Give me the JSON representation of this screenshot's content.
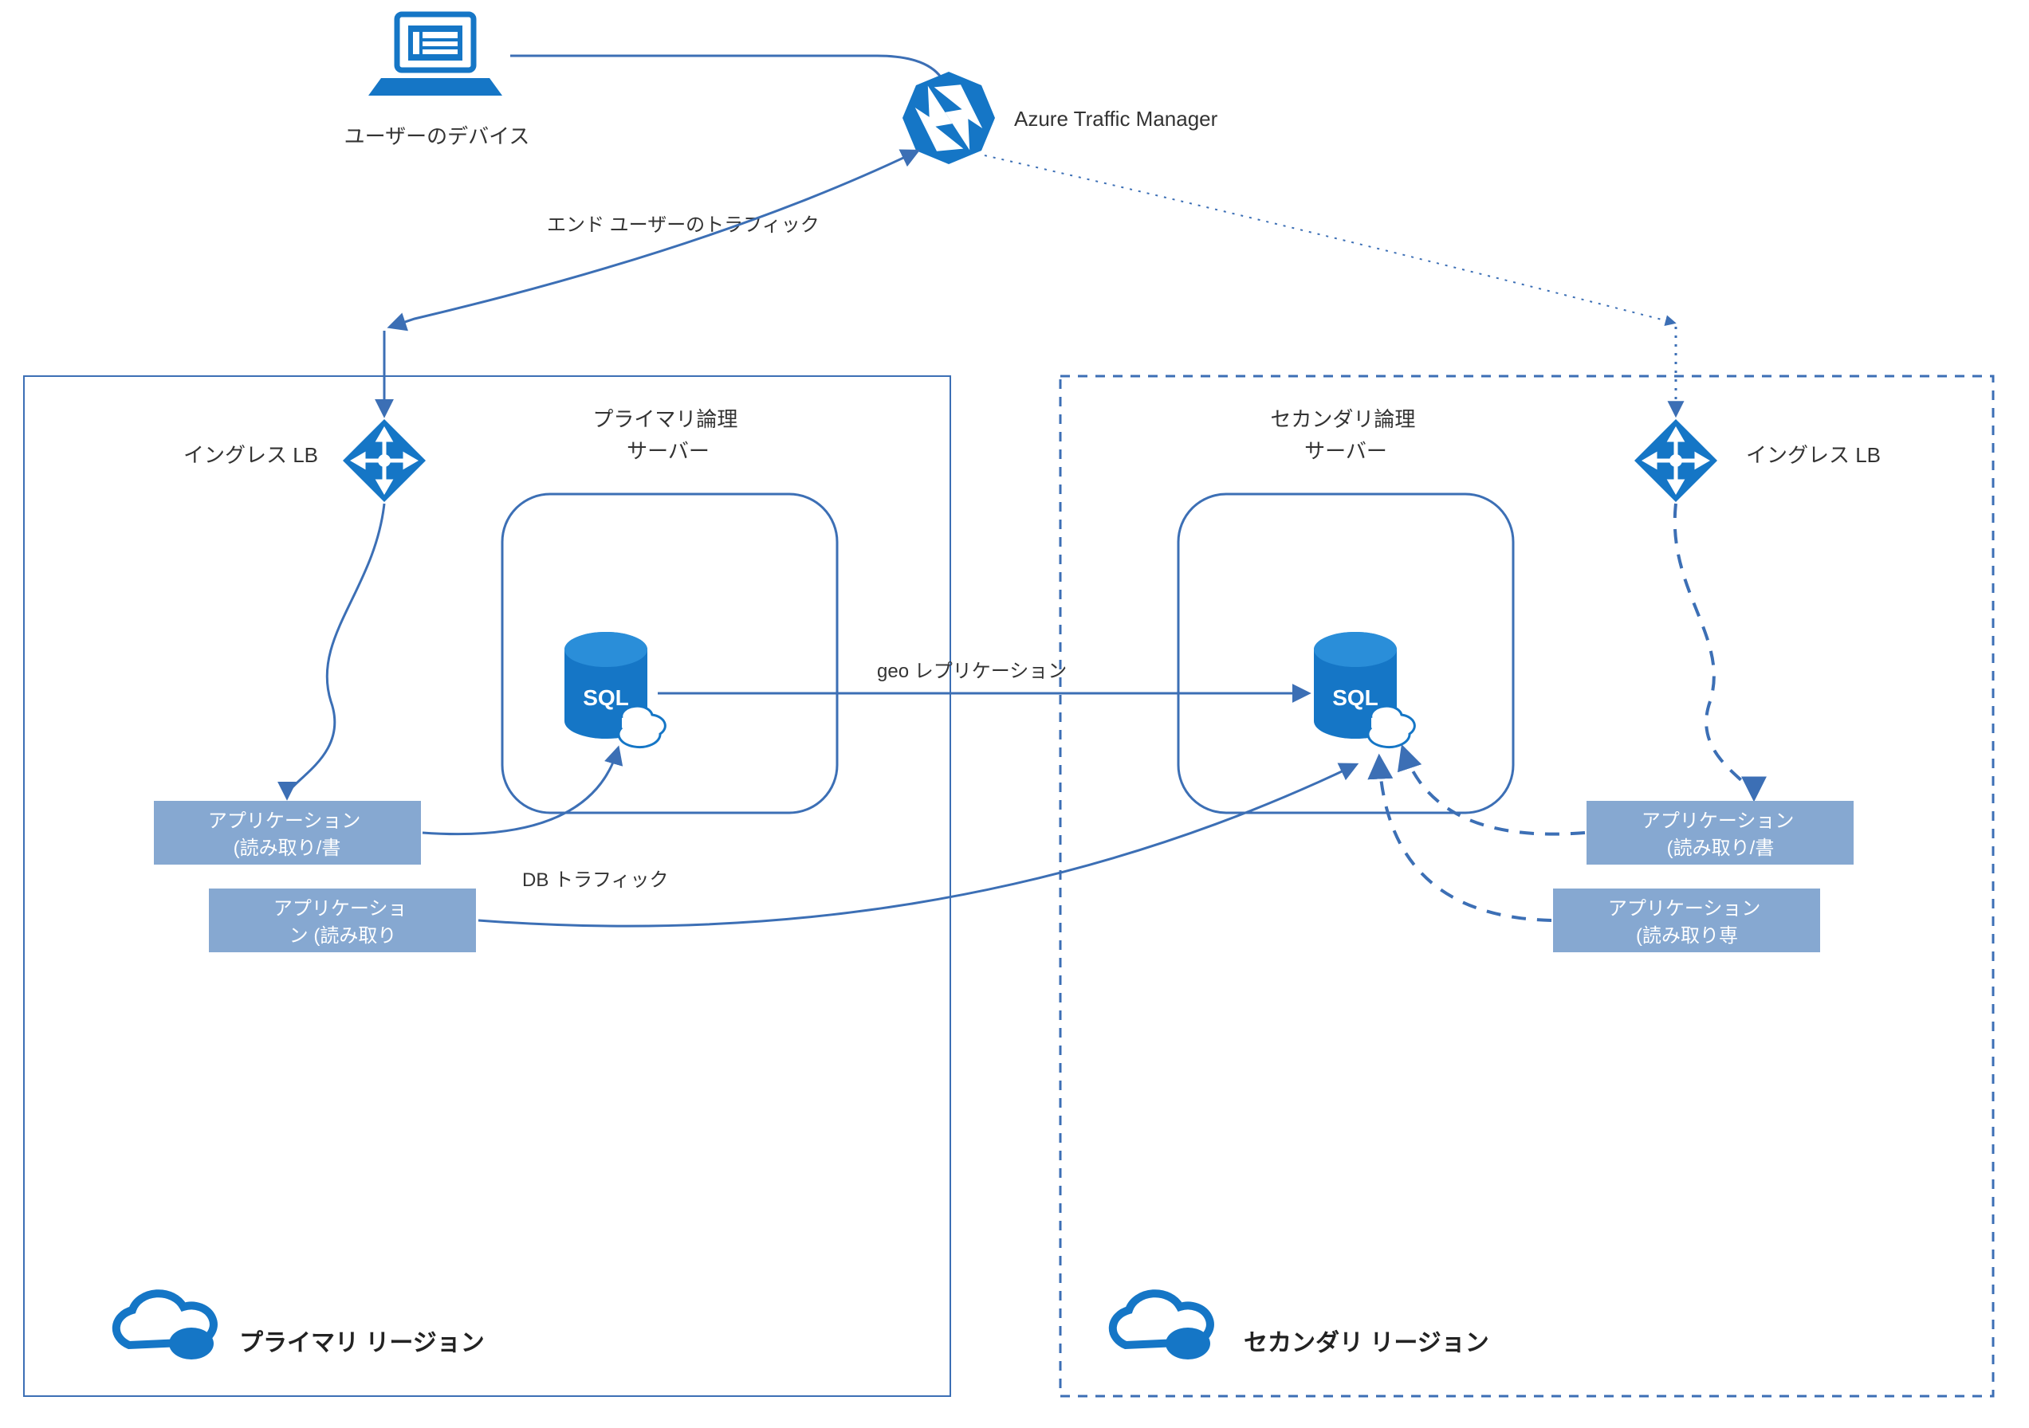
{
  "colors": {
    "azure_blue": "#1576c6",
    "stroke_blue": "#3c6fb5",
    "app_box": "#86a8d1",
    "text": "#333333"
  },
  "top": {
    "user_device_label": "ユーザーのデバイス",
    "traffic_manager_label": "Azure Traffic Manager",
    "end_user_traffic_label": "エンド ユーザーのトラフィック"
  },
  "connectors": {
    "geo_replication_label": "geo レプリケーション",
    "db_traffic_label": "DB トラフィック"
  },
  "primary": {
    "region_title": "プライマリ リージョン",
    "ingress_lb_label": "イングレス LB",
    "logical_server_label_line1": "プライマリ論理",
    "logical_server_label_line2": "サーバー",
    "app_rw_line1": "アプリケーション",
    "app_rw_line2": "(読み取り/書",
    "app_ro_line1": "アプリケーショ",
    "app_ro_line2": "ン (読み取り"
  },
  "secondary": {
    "region_title": "セカンダリ リージョン",
    "ingress_lb_label": "イングレス LB",
    "logical_server_label_line1": "セカンダリ論理",
    "logical_server_label_line2": "サーバー",
    "app_rw_line1": "アプリケーション",
    "app_rw_line2": "(読み取り/書",
    "app_ro_line1": "アプリケーション",
    "app_ro_line2": "(読み取り専"
  }
}
